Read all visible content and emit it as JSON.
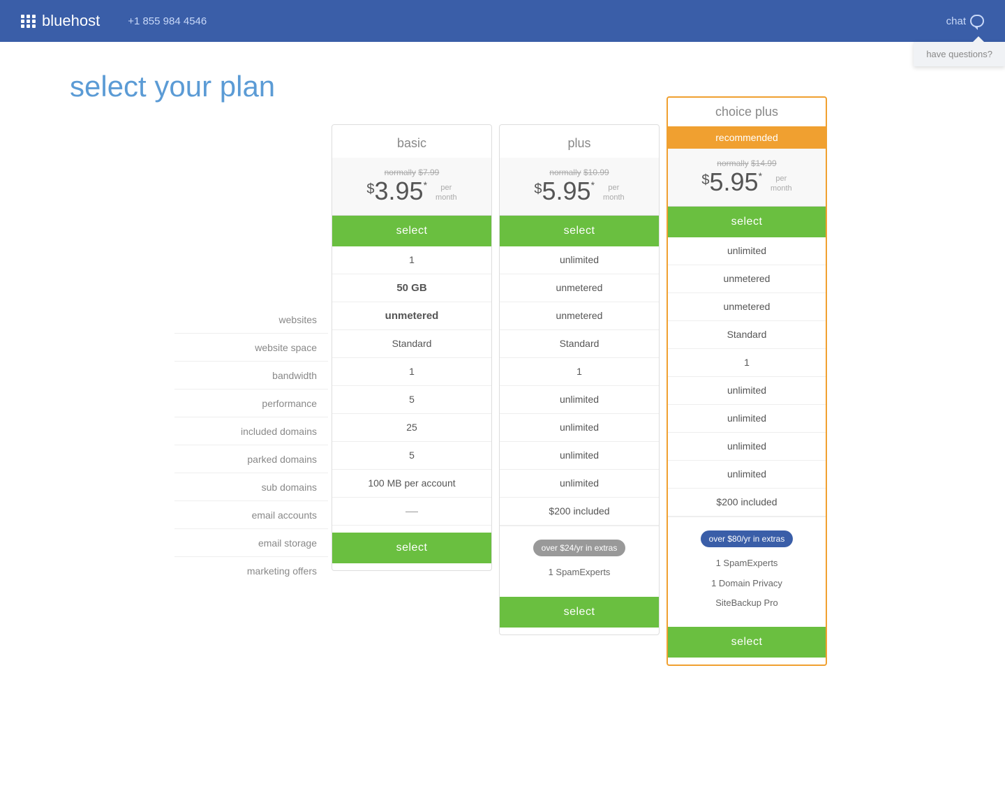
{
  "header": {
    "logo_text": "bluehost",
    "phone": "+1 855 984 4546",
    "chat_label": "chat",
    "have_questions": "have questions?"
  },
  "page": {
    "title": "select your plan"
  },
  "labels": {
    "websites": "websites",
    "website_space": "website space",
    "bandwidth": "bandwidth",
    "performance": "performance",
    "included_domains": "included domains",
    "parked_domains": "parked domains",
    "sub_domains": "sub domains",
    "email_accounts": "email accounts",
    "email_storage": "email storage",
    "marketing_offers": "marketing offers"
  },
  "plans": {
    "basic": {
      "name": "basic",
      "normally": "normally",
      "original_price": "$7.99",
      "price_dollar": "$",
      "price_main": "3.95",
      "price_asterisk": "*",
      "price_per": "per\nmonth",
      "select_label": "select",
      "websites": "1",
      "website_space": "50 GB",
      "bandwidth": "unmetered",
      "performance": "Standard",
      "included_domains": "1",
      "parked_domains": "5",
      "sub_domains": "25",
      "email_accounts": "5",
      "email_storage": "100 MB per account",
      "marketing_offers": "—",
      "select_bottom_label": "select"
    },
    "plus": {
      "name": "plus",
      "normally": "normally",
      "original_price": "$10.99",
      "price_dollar": "$",
      "price_main": "5.95",
      "price_asterisk": "*",
      "price_per": "per\nmonth",
      "select_label": "select",
      "websites": "unlimited",
      "website_space": "unmetered",
      "bandwidth": "unmetered",
      "performance": "Standard",
      "included_domains": "1",
      "parked_domains": "unlimited",
      "sub_domains": "unlimited",
      "email_accounts": "unlimited",
      "email_storage": "unlimited",
      "marketing_offers": "$200 included",
      "extras_badge": "over $24/yr in extras",
      "extras_item1": "1 SpamExperts",
      "select_bottom_label": "select"
    },
    "choice_plus": {
      "name": "choice plus",
      "recommended_label": "recommended",
      "normally": "normally",
      "original_price": "$14.99",
      "price_dollar": "$",
      "price_main": "5.95",
      "price_asterisk": "*",
      "price_per": "per\nmonth",
      "select_label": "select",
      "websites": "unlimited",
      "website_space": "unmetered",
      "bandwidth": "unmetered",
      "performance": "Standard",
      "included_domains": "1",
      "parked_domains": "unlimited",
      "sub_domains": "unlimited",
      "email_accounts": "unlimited",
      "email_storage": "unlimited",
      "marketing_offers": "$200 included",
      "extras_badge": "over $80/yr in extras",
      "extras_item1": "1 SpamExperts",
      "extras_item2": "1 Domain Privacy",
      "extras_item3": "SiteBackup Pro",
      "select_bottom_label": "select"
    }
  }
}
